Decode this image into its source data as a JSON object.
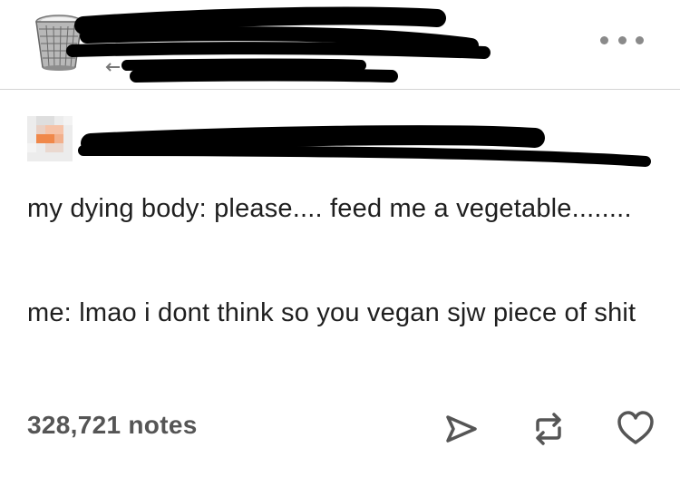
{
  "post": {
    "header": {
      "more_label": "More options"
    },
    "body": {
      "paragraph1": "my dying body: please.... feed me a vegetable........",
      "paragraph2": "me: lmao i dont think so you vegan sjw piece of shit"
    },
    "footer": {
      "notes": "328,721 notes"
    }
  },
  "colors": {
    "text": "#1f1f1f",
    "notes": "#555555",
    "icon": "#555555",
    "divider": "#d4d4d4",
    "redaction": "#000000"
  },
  "icons": [
    "trash-bin-avatar-icon",
    "more-options-icon",
    "share-icon",
    "reblog-icon",
    "like-heart-icon"
  ]
}
